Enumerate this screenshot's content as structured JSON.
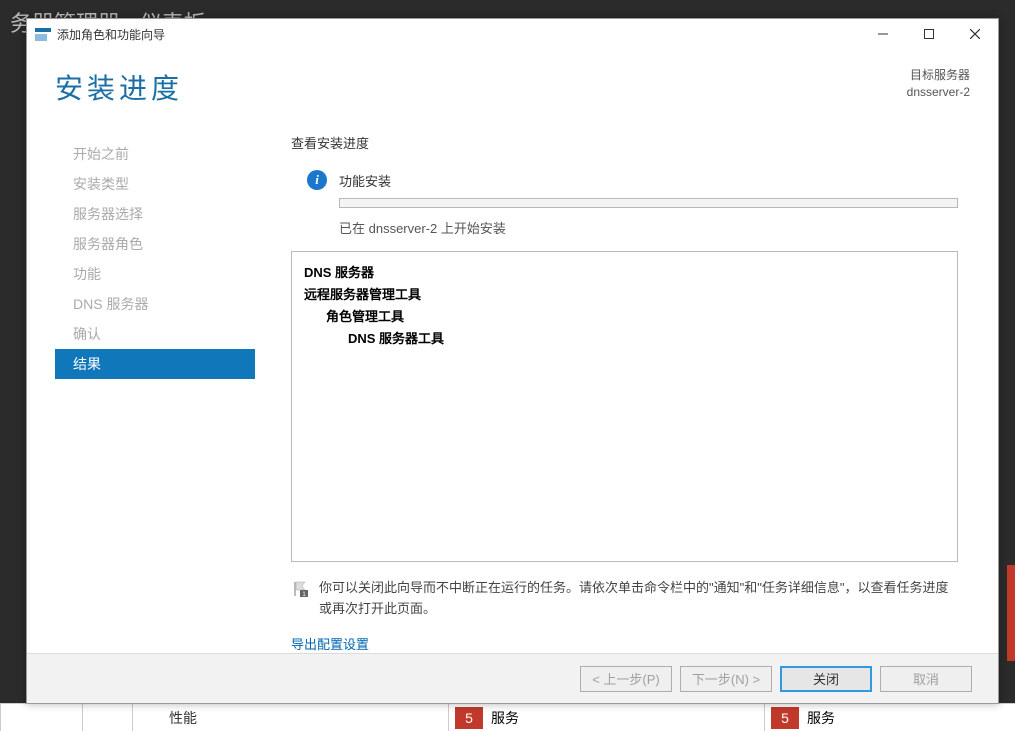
{
  "background": {
    "top_fragment": "务器管理器 · 仪表板",
    "perf_label": "性能",
    "service_label": "服务",
    "badge_count": "5"
  },
  "titlebar": {
    "title": "添加角色和功能向导"
  },
  "header": {
    "heading": "安装进度",
    "target_label": "目标服务器",
    "target_server": "dnsserver-2"
  },
  "steps": [
    "开始之前",
    "安装类型",
    "服务器选择",
    "服务器角色",
    "功能",
    "DNS 服务器",
    "确认",
    "结果"
  ],
  "active_step_index": 7,
  "main": {
    "section_label": "查看安装进度",
    "status_text": "功能安装",
    "progress_sub": "已在 dnsserver-2 上开始安装",
    "details": {
      "line1": "DNS 服务器",
      "line2": "远程服务器管理工具",
      "line3": "角色管理工具",
      "line4": "DNS 服务器工具"
    },
    "hint_text": "你可以关闭此向导而不中断正在运行的任务。请依次单击命令栏中的\"通知\"和\"任务详细信息\"，以查看任务进度或再次打开此页面。",
    "export_link": "导出配置设置"
  },
  "footer": {
    "prev": "< 上一步(P)",
    "next": "下一步(N) >",
    "close": "关闭",
    "cancel": "取消"
  }
}
